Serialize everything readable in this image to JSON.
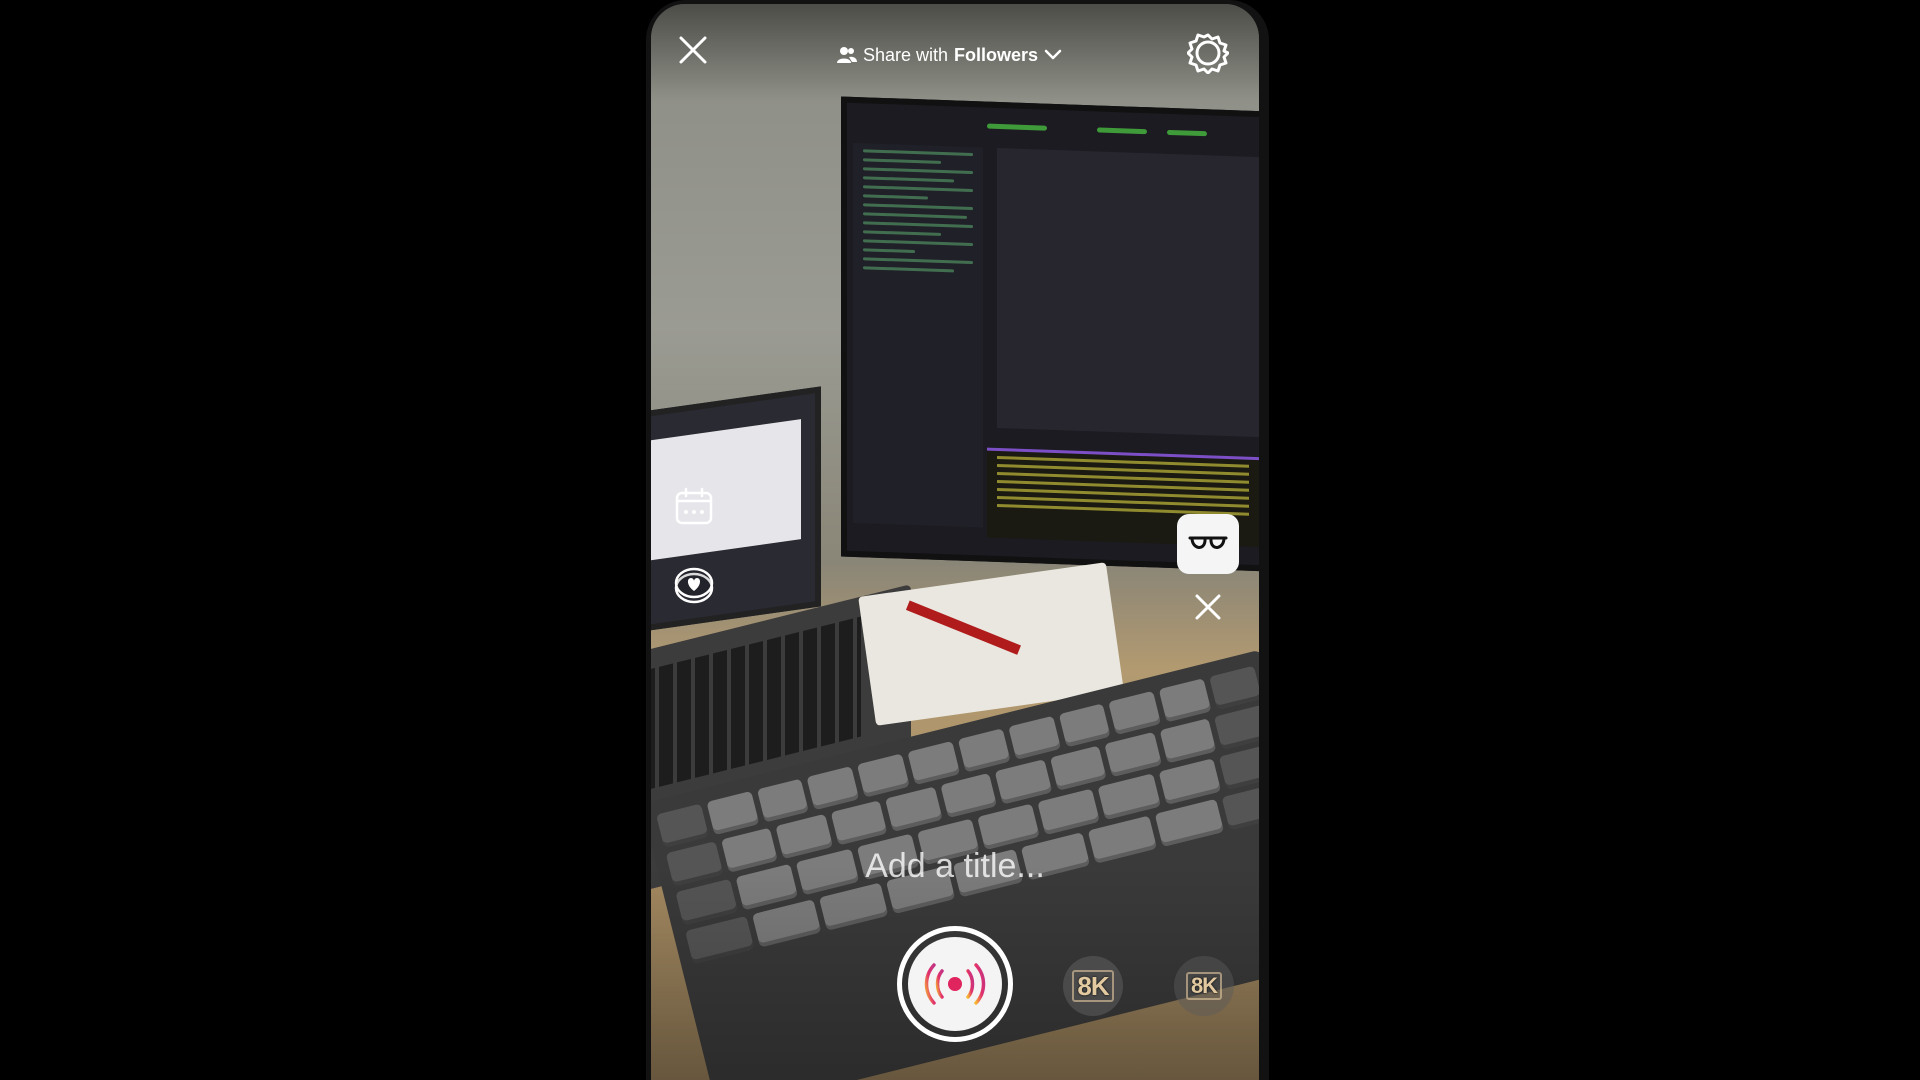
{
  "header": {
    "close_label": "Close",
    "share_prefix": "Share with",
    "share_audience": "Followers",
    "settings_label": "Settings"
  },
  "side_tools": {
    "calendar_label": "Schedule",
    "fundraiser_label": "Fundraiser"
  },
  "effects": {
    "active_effect_icon": "glasses-icon",
    "remove_label": "Remove effect"
  },
  "title": {
    "placeholder": "Add a title..."
  },
  "bottom": {
    "live_icon": "broadcast-icon",
    "badge_a": "8K",
    "badge_b": "8K"
  },
  "colors": {
    "accent_live_gradient": [
      "#f7b733",
      "#e1306c",
      "#c13584"
    ],
    "record_dot": "#e0245e"
  }
}
